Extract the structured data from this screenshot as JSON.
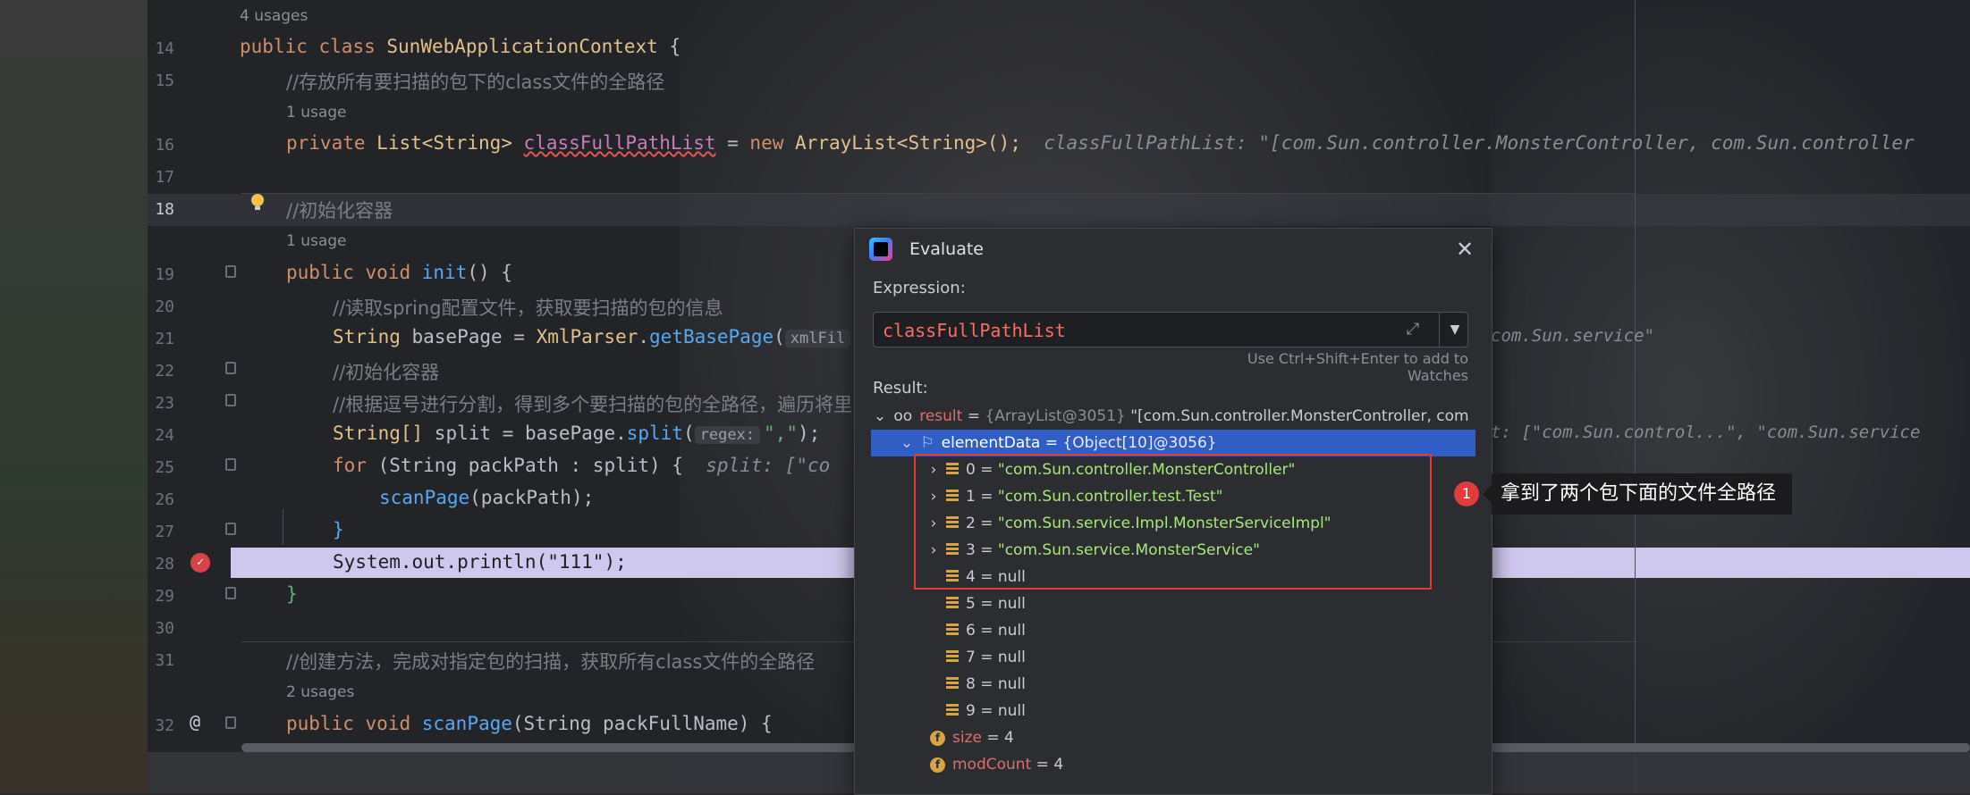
{
  "editor": {
    "line_numbers": [
      "14",
      "15",
      "16",
      "17",
      "18",
      "19",
      "20",
      "21",
      "22",
      "23",
      "24",
      "25",
      "26",
      "27",
      "28",
      "29",
      "30",
      "31",
      "32"
    ],
    "current_line": "18",
    "usages_top": "4 usages",
    "usages_field": "1 usage",
    "usages_init": "1 usage",
    "usages_scan": "2 usages",
    "line14": {
      "k1": "public",
      "k2": "class",
      "cls": "SunWebApplicationContext",
      "tail": " {"
    },
    "line15_comment": "//存放所有要扫描的包下的class文件的全路径",
    "line16": {
      "k1": "private",
      "type": "List<String>",
      "field": "classFullPathList",
      "eq": " = ",
      "k2": "new",
      "ctor": "ArrayList<String>();",
      "debug": "classFullPathList: \"[com.Sun.controller.MonsterController, com.Sun.controller"
    },
    "line18_comment": "//初始化容器",
    "line19": {
      "k1": "public",
      "k2": "void",
      "fn": "init",
      "tail": "() {"
    },
    "line20_comment": "//读取spring配置文件，获取要扫描的包的信息",
    "line21": {
      "type": "String",
      "var": " basePage = ",
      "cls": "XmlParser",
      "dot": ".",
      "fn": "getBasePage",
      "paren": "(",
      "hint": "xmlFil",
      "debug": "com.Sun.service\""
    },
    "line22_comment": "//初始化容器",
    "line23_comment": "//根据逗号进行分割，得到多个要扫描的包的全路径，遍历将里",
    "line24": {
      "type": "String[]",
      "var": " split = basePage.",
      "fn": "split",
      "paren": "(",
      "hint": "regex:",
      "arg": "\",\"",
      "tail": ");",
      "debug": "t: [\"com.Sun.control...\", \"com.Sun.service"
    },
    "line25": {
      "k1": "for",
      "mid": " (String packPath : split) {",
      "debug": "split: [\"co"
    },
    "line26": {
      "fn": "scanPage",
      "tail": "(packPath);"
    },
    "line27": "}",
    "line28": {
      "pre": "System.out.println(",
      "arg": "\"111\"",
      "tail": ");"
    },
    "line29": "}",
    "line31_comment": "//创建方法，完成对指定包的扫描，获取所有class文件的全路径",
    "line32": {
      "k1": "public",
      "k2": "void",
      "fn": "scanPage",
      "args": "(String packFullName) {"
    }
  },
  "dialog": {
    "title": "Evaluate",
    "close_glyph": "✕",
    "expression_label": "Expression:",
    "expression_value": "classFullPathList",
    "expand_glyph": "⤢",
    "dropdown_glyph": "▼",
    "watch_hint": "Use Ctrl+Shift+Enter to add to Watches",
    "result_label": "Result:",
    "result_node": {
      "arrow": "⌄",
      "icon": "oo",
      "name": "result",
      "eq": " = ",
      "ref": "{ArrayList@3051}",
      "preview": " \"[com.Sun.controller.MonsterController, com"
    },
    "element_node": {
      "arrow": "⌄",
      "name": "elementData",
      "eq": " = ",
      "ref": "{Object[10]@3056}"
    },
    "items": [
      {
        "arrow": "›",
        "label": "0 = ",
        "value": "\"com.Sun.controller.MonsterController\""
      },
      {
        "arrow": "›",
        "label": "1 = ",
        "value": "\"com.Sun.controller.test.Test\""
      },
      {
        "arrow": "›",
        "label": "2 = ",
        "value": "\"com.Sun.service.Impl.MonsterServiceImpl\""
      },
      {
        "arrow": "›",
        "label": "3 = ",
        "value": "\"com.Sun.service.MonsterService\""
      },
      {
        "arrow": "",
        "label": "4 = ",
        "value": "null"
      },
      {
        "arrow": "",
        "label": "5 = ",
        "value": "null"
      },
      {
        "arrow": "",
        "label": "6 = ",
        "value": "null"
      },
      {
        "arrow": "",
        "label": "7 = ",
        "value": "null"
      },
      {
        "arrow": "",
        "label": "8 = ",
        "value": "null"
      },
      {
        "arrow": "",
        "label": "9 = ",
        "value": "null"
      }
    ],
    "size_field": {
      "icon": "f",
      "name": "size",
      "eq": " = ",
      "value": "4"
    },
    "modcount_field": {
      "icon": "f",
      "name": "modCount",
      "eq": " = ",
      "value": "4"
    }
  },
  "annotation": {
    "badge": "1",
    "text": "拿到了两个包下面的文件全路径"
  },
  "colors": {
    "accent_selection": "#2e5ec6",
    "annotation_red": "#e23b3b",
    "breakpoint_red": "#d8434a"
  }
}
